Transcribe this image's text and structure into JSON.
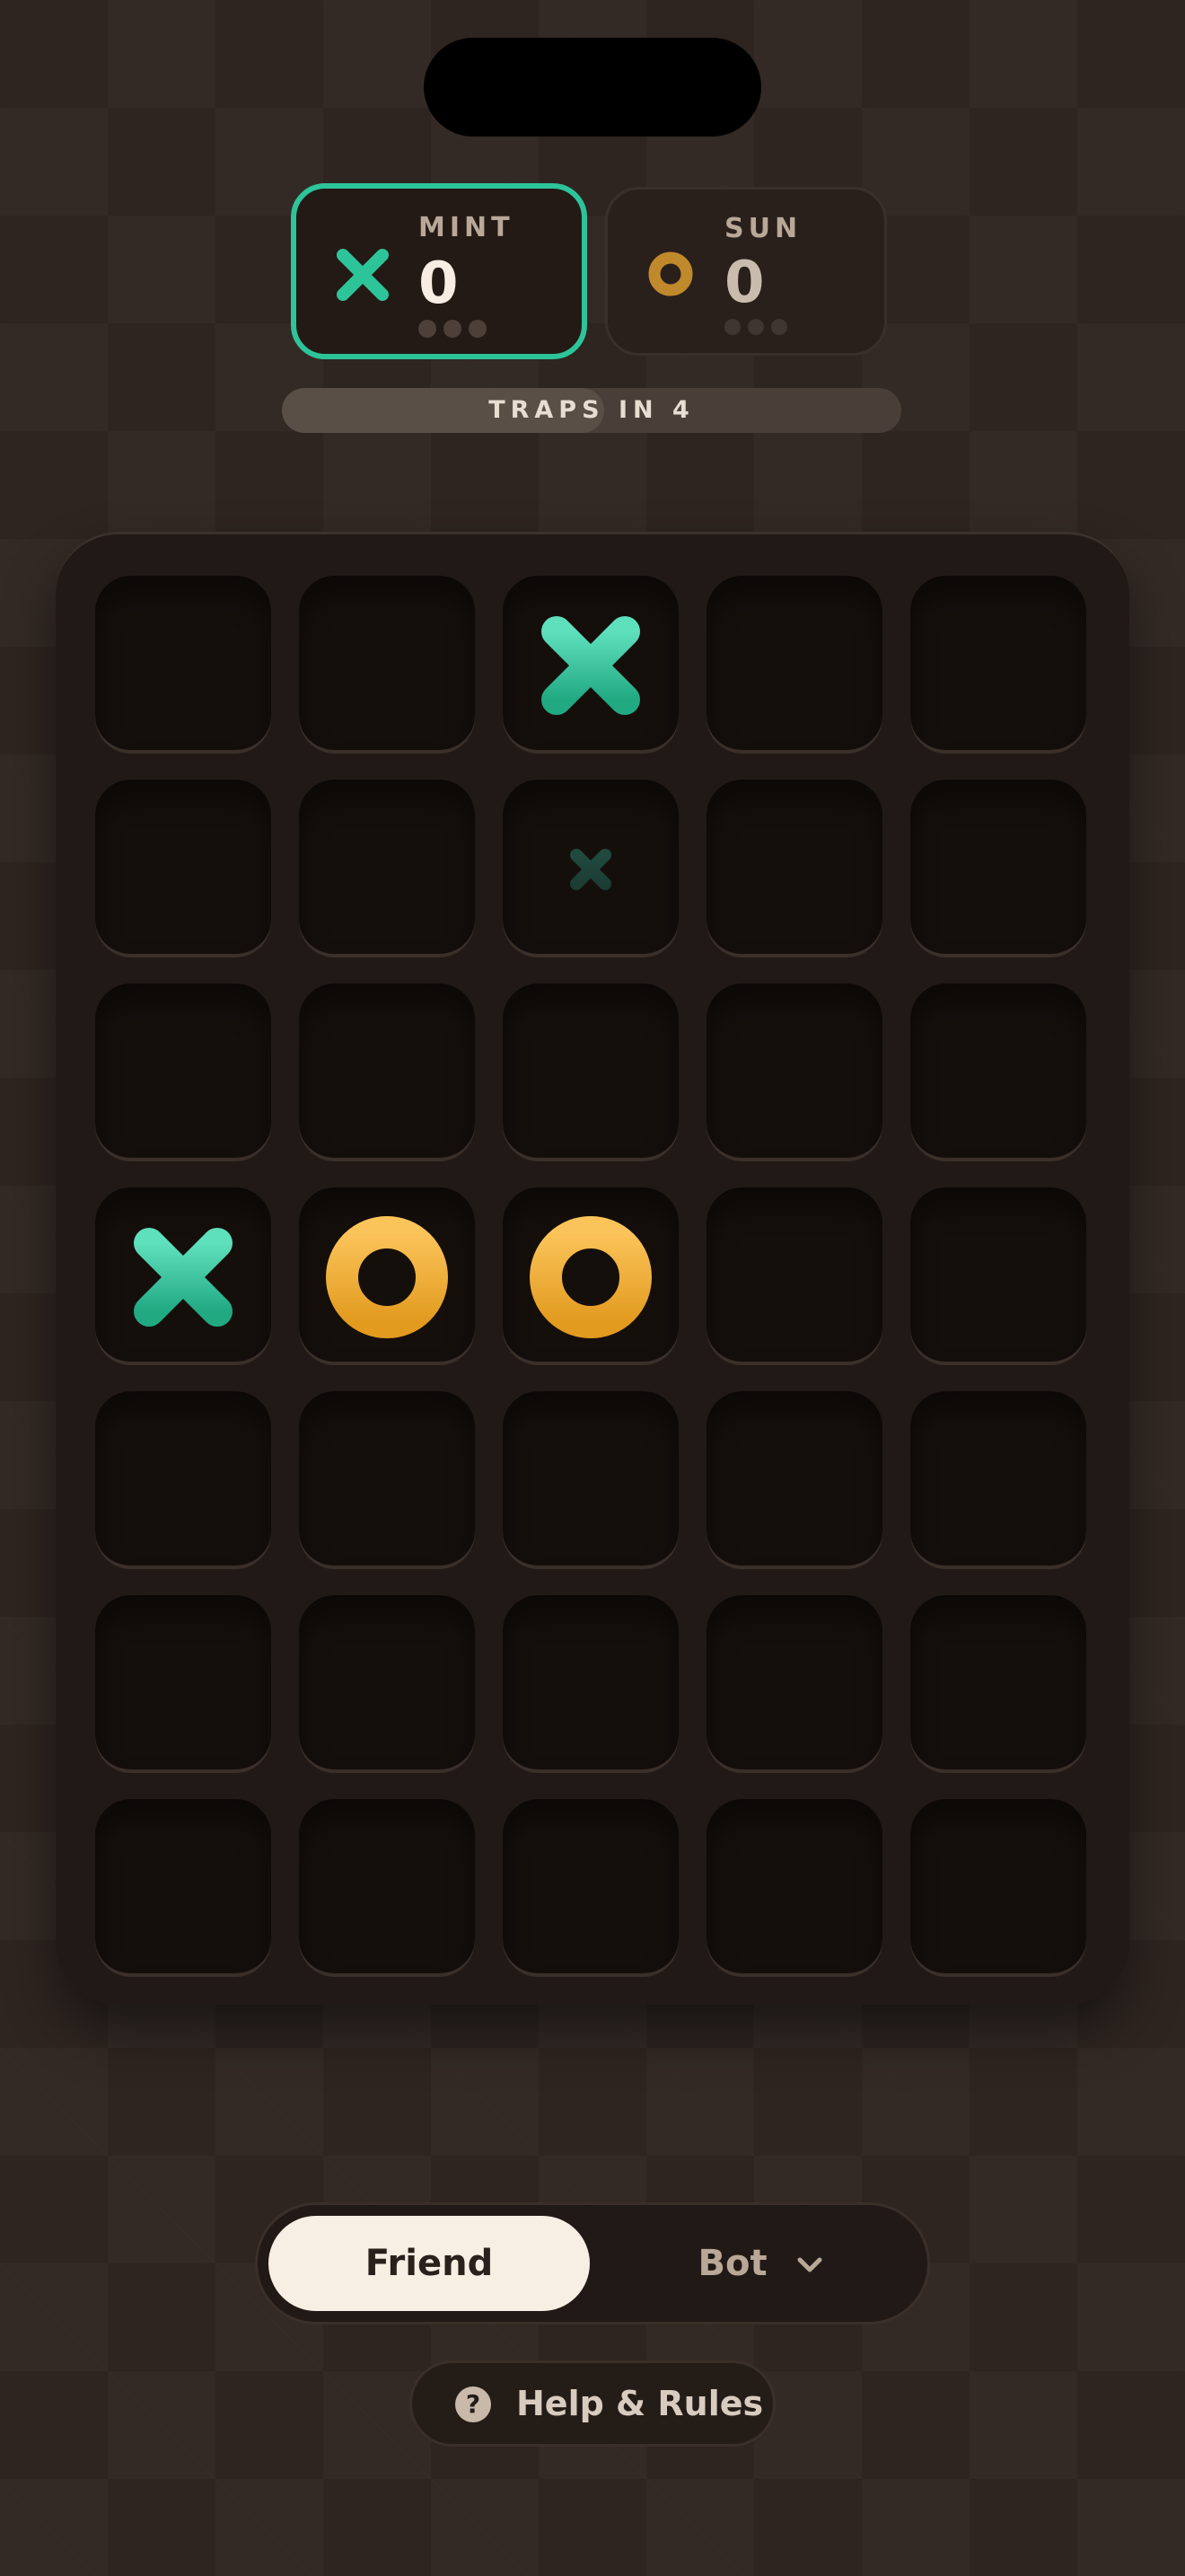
{
  "players": {
    "mint": {
      "name": "MINT",
      "score": "0",
      "color": "#2ec49a",
      "symbol": "x-icon",
      "active": true,
      "dots": 3
    },
    "sun": {
      "name": "SUN",
      "score": "0",
      "color": "#c08a2c",
      "symbol": "o-icon",
      "active": false,
      "dots": 3
    }
  },
  "traps": {
    "label": "TRAPS IN 4",
    "progress": 0.52
  },
  "board": {
    "rows": 7,
    "cols": 5,
    "pieces": [
      {
        "row": 0,
        "col": 2,
        "type": "x"
      },
      {
        "row": 1,
        "col": 2,
        "type": "x-ghost"
      },
      {
        "row": 3,
        "col": 0,
        "type": "x"
      },
      {
        "row": 3,
        "col": 1,
        "type": "o"
      },
      {
        "row": 3,
        "col": 2,
        "type": "o"
      }
    ]
  },
  "mode": {
    "friend_label": "Friend",
    "bot_label": "Bot",
    "selected": "Friend"
  },
  "help": {
    "label": "Help & Rules",
    "icon": "?"
  }
}
